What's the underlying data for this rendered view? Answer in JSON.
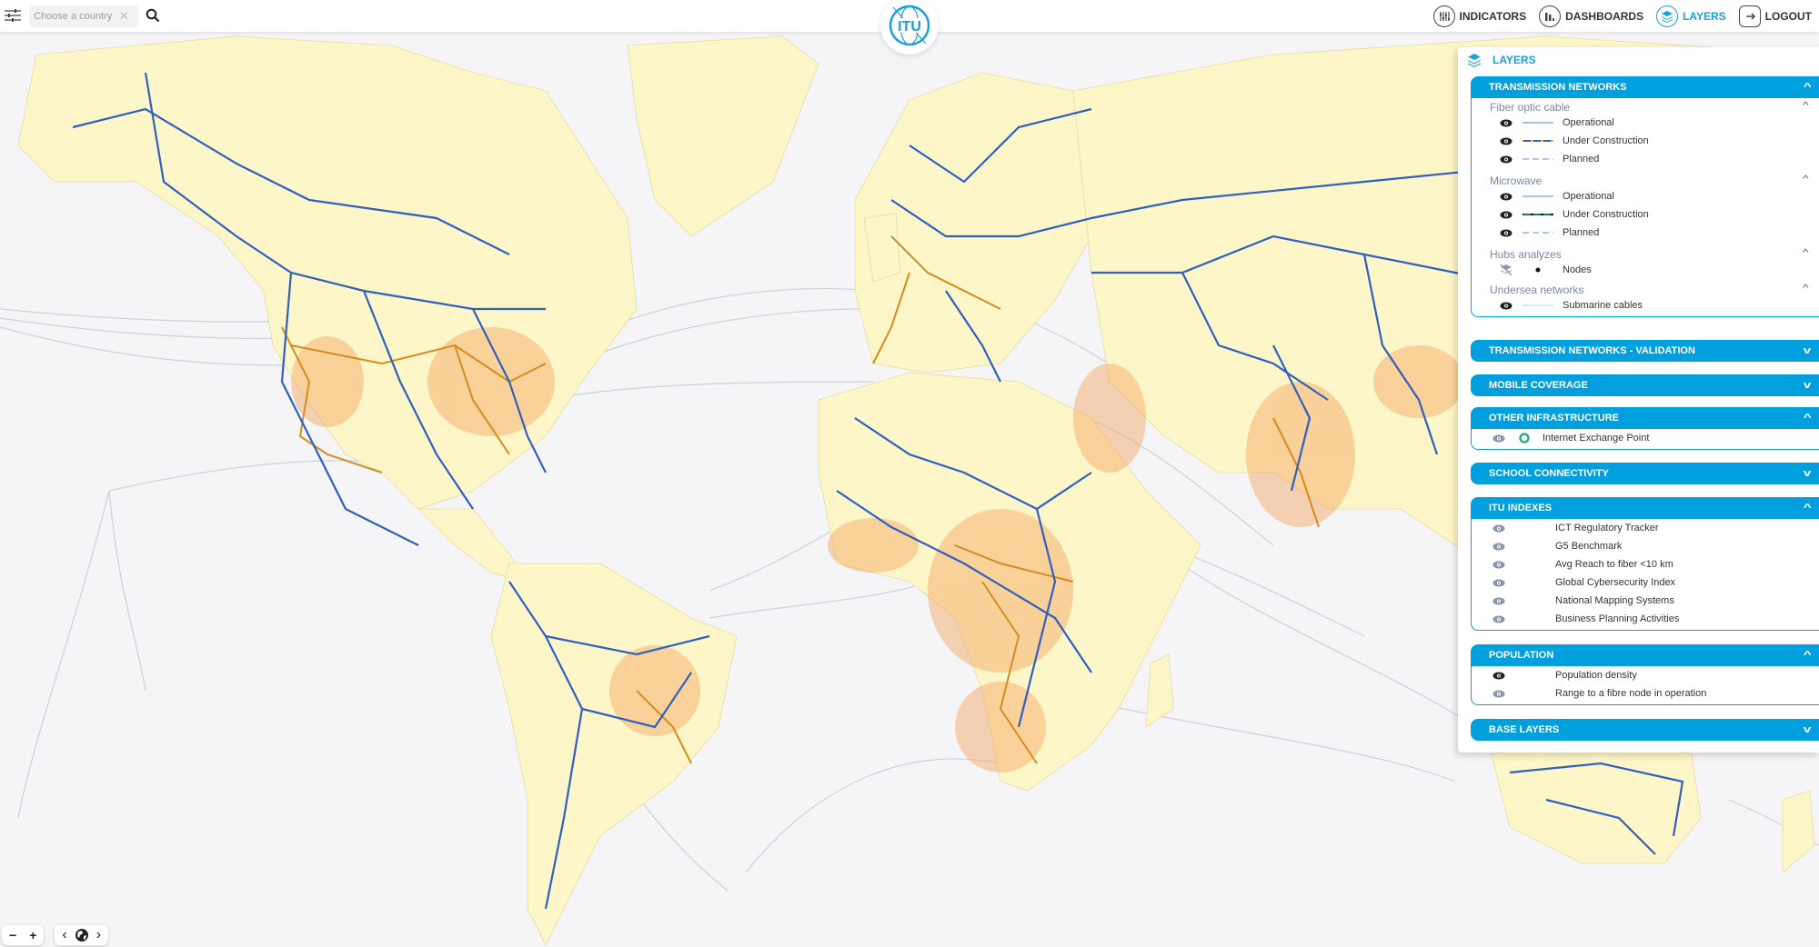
{
  "topbar": {
    "search_placeholder": "Choose a country",
    "nav": [
      {
        "label": "INDICATORS",
        "icon": "sliders-icon",
        "active": false
      },
      {
        "label": "DASHBOARDS",
        "icon": "bar-chart-icon",
        "active": false
      },
      {
        "label": "LAYERS",
        "icon": "layers-icon",
        "active": true
      },
      {
        "label": "LOGOUT",
        "icon": "logout-icon",
        "active": false
      }
    ],
    "logo_text": "ITU"
  },
  "layers_panel": {
    "title": "LAYERS",
    "sections": {
      "transmission": {
        "title": "TRANSMISSION NETWORKS",
        "expanded": true,
        "groups": {
          "fiber": {
            "title": "Fiber optic cable",
            "items": [
              {
                "label": "Operational",
                "visible": true
              },
              {
                "label": "Under Construction",
                "visible": true
              },
              {
                "label": "Planned",
                "visible": true
              }
            ]
          },
          "microwave": {
            "title": "Microwave",
            "items": [
              {
                "label": "Operational",
                "visible": true
              },
              {
                "label": "Under Construction",
                "visible": true
              },
              {
                "label": "Planned",
                "visible": true
              }
            ]
          },
          "hubs": {
            "title": "Hubs analyzes",
            "items": [
              {
                "label": "Nodes",
                "visible": false
              }
            ]
          },
          "undersea": {
            "title": "Undersea networks",
            "items": [
              {
                "label": "Submarine cables",
                "visible": true
              }
            ]
          }
        }
      },
      "validation": {
        "title": "TRANSMISSION NETWORKS - VALIDATION",
        "expanded": false
      },
      "mobile": {
        "title": "MOBILE COVERAGE",
        "expanded": false
      },
      "other": {
        "title": "OTHER INFRASTRUCTURE",
        "expanded": true,
        "items": [
          {
            "label": "Internet Exchange Point",
            "visible": false
          }
        ]
      },
      "school": {
        "title": "SCHOOL CONNECTIVITY",
        "expanded": false
      },
      "itu": {
        "title": "ITU INDEXES",
        "expanded": true,
        "items": [
          {
            "label": "ICT Regulatory Tracker",
            "visible": false
          },
          {
            "label": "G5 Benchmark",
            "visible": false
          },
          {
            "label": "Avg Reach to fiber <10 km",
            "visible": false
          },
          {
            "label": "Global Cybersecurity Index",
            "visible": false
          },
          {
            "label": "National Mapping Systems",
            "visible": false
          },
          {
            "label": "Business Planning Activities",
            "visible": false
          }
        ]
      },
      "population": {
        "title": "POPULATION",
        "expanded": true,
        "items": [
          {
            "label": "Population density",
            "visible": true
          },
          {
            "label": "Range to a fibre node in operation",
            "visible": false
          }
        ]
      },
      "base": {
        "title": "BASE LAYERS",
        "expanded": false
      }
    }
  },
  "colors": {
    "accent": "#00a0df",
    "fiber_operational": "#2f5fbf",
    "fiber_construction": "#d98a1f",
    "microwave": "#4caf9a",
    "land": "#fdf6c8",
    "ocean": "#f5f5f7",
    "submarine": "#c6cad6",
    "population": "#f4a460"
  },
  "map_controls": {
    "zoom_out": "−",
    "zoom_in": "+",
    "prev": "‹",
    "next": "›"
  }
}
